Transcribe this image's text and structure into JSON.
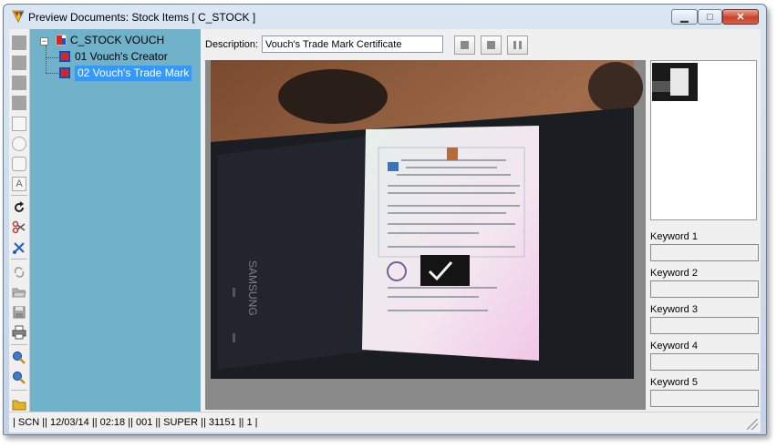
{
  "window": {
    "title": "Preview Documents: Stock Items [ C_STOCK ]"
  },
  "tree": {
    "root": "C_STOCK VOUCH",
    "items": [
      {
        "label": "01 Vouch's Creator",
        "selected": false
      },
      {
        "label": "02 Vouch's Trade Mark",
        "selected": true
      }
    ]
  },
  "description": {
    "label": "Description:",
    "value": "Vouch's Trade Mark Certificate"
  },
  "keywords": [
    {
      "label": "Keyword 1",
      "value": ""
    },
    {
      "label": "Keyword 2",
      "value": ""
    },
    {
      "label": "Keyword 3",
      "value": ""
    },
    {
      "label": "Keyword 4",
      "value": ""
    },
    {
      "label": "Keyword 5",
      "value": ""
    }
  ],
  "preview": {
    "phone_brand": "SAMSUNG"
  },
  "status": {
    "text": "| SCN  || 12/03/14  || 02:18  || 001  || SUPER  || 31151  || 1 |"
  },
  "colors": {
    "tree_background": "#6fb2c9",
    "selection": "#3399ff",
    "viewer_background": "#898989",
    "close_button": "#c8412b"
  },
  "icons": {
    "toolbar": [
      "square-shape-icon",
      "square-shape-icon",
      "square-shape-icon",
      "square-shape-icon",
      "rectangle-outline-icon",
      "circle-outline-icon",
      "rounded-rectangle-icon",
      "text-box-icon",
      "rotate-icon",
      "scissors-red-icon",
      "cut-blue-icon",
      "recycle-icon",
      "open-folder-icon",
      "save-disk-icon",
      "print-icon",
      "zoom-in-icon",
      "zoom-out-icon",
      "folder-icon"
    ]
  }
}
